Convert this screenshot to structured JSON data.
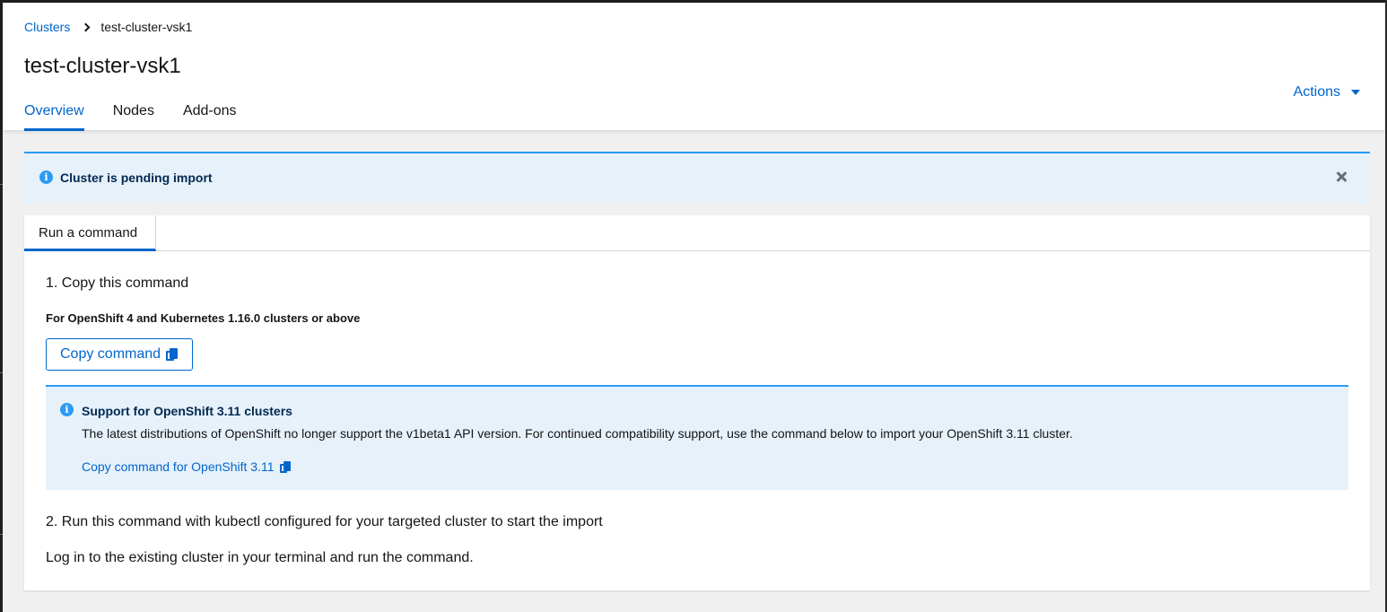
{
  "breadcrumb": {
    "parent_label": "Clusters",
    "current_label": "test-cluster-vsk1"
  },
  "header": {
    "title": "test-cluster-vsk1",
    "actions_label": "Actions"
  },
  "tabs": [
    {
      "label": "Overview",
      "active": true
    },
    {
      "label": "Nodes",
      "active": false
    },
    {
      "label": "Add-ons",
      "active": false
    }
  ],
  "alert": {
    "title": "Cluster is pending import",
    "variant": "info"
  },
  "card": {
    "tab_label": "Run a command",
    "step1_title": "1. Copy this command",
    "subtitle": "For OpenShift 4 and Kubernetes 1.16.0 clusters or above",
    "copy_button_label": "Copy command",
    "inline_alert": {
      "title": "Support for OpenShift 3.11 clusters",
      "body": "The latest distributions of OpenShift no longer support the v1beta1 API version. For continued compatibility support, use the command below to import your OpenShift 3.11 cluster.",
      "link_label": "Copy command for OpenShift 3.11"
    },
    "step2_title": "2. Run this command with kubectl configured for your targeted cluster to start the import",
    "step2_body": "Log in to the existing cluster in your terminal and run the command."
  },
  "colors": {
    "accent": "#0066cc",
    "info": "#2b9af3",
    "info_bg": "#e7f1fa",
    "page_bg": "#f0f0f0"
  }
}
